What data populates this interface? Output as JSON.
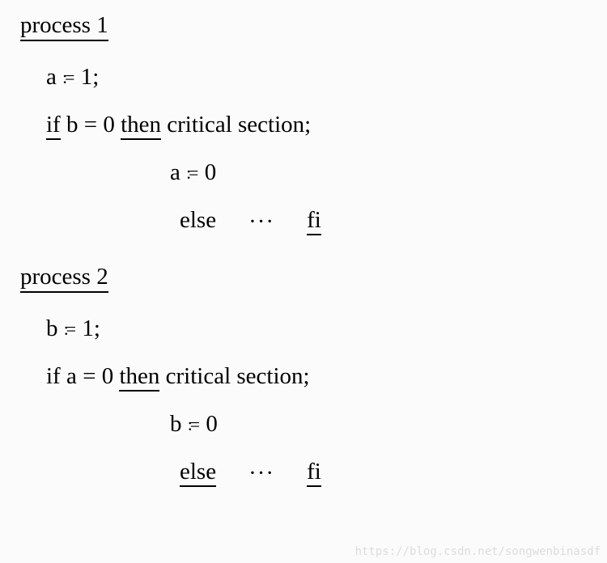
{
  "process1": {
    "heading": "process 1",
    "line1_a": "a",
    "line1_eq": ":=",
    "line1_val": "1;",
    "line2_if": "if",
    "line2_cond": " b = 0 ",
    "line2_then": "then",
    "line2_rest": " critical section;",
    "line3_a": "a",
    "line3_eq": ":=",
    "line3_val": "0",
    "line4_else": "else",
    "line4_dots": "···",
    "line4_fi": "fi"
  },
  "process2": {
    "heading": "process 2",
    "line1_b": "b",
    "line1_eq": ":=",
    "line1_val": "1;",
    "line2_if": "if a = 0 ",
    "line2_then": "then",
    "line2_rest": " critical section;",
    "line3_b": "b",
    "line3_eq": ":=",
    "line3_val": "0",
    "line4_else": "else",
    "line4_dots": "···",
    "line4_fi": "fi"
  },
  "watermark": "https://blog.csdn.net/songwenbinasdf"
}
